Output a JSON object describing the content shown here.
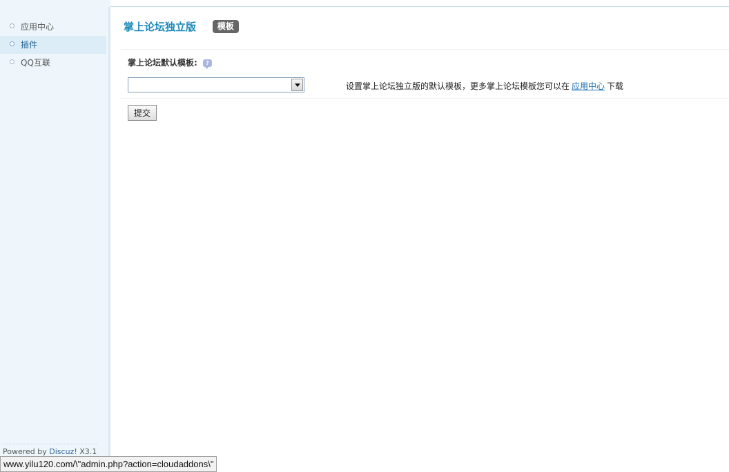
{
  "sidebar": {
    "items": [
      {
        "label": "应用中心",
        "active": false
      },
      {
        "label": "插件",
        "active": true
      },
      {
        "label": "QQ互联",
        "active": false
      }
    ],
    "powered_prefix": "Powered by ",
    "powered_brand": "Discuz!",
    "powered_version": " X3.1"
  },
  "main": {
    "title": "掌上论坛独立版",
    "tab": "模板",
    "setting": {
      "label": "掌上论坛默认模板:",
      "help_icon": "?",
      "select_value": "",
      "desc_before": "设置掌上论坛独立版的默认模板，更多掌上论坛模板您可以在",
      "desc_link": "应用中心",
      "desc_after": "下载"
    },
    "submit_label": "提交"
  },
  "status_bar": {
    "url": "www.yilu120.com/\\\"admin.php?action=cloudaddons\\\""
  },
  "colors": {
    "title": "#1c8ab9",
    "sidebar_bg": "#eef6fb",
    "sidebar_active": "#dcedf8",
    "tab_bg": "#666666",
    "link": "#1c6fb0"
  },
  "icons": {
    "menu_bullet": "circle-bullet-icon",
    "help": "help-bubble-icon",
    "dropdown": "chevron-down-icon"
  }
}
